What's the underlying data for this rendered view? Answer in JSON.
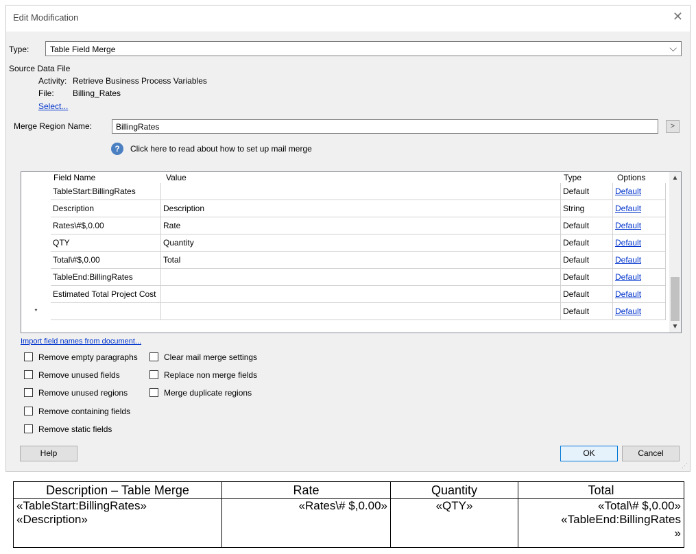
{
  "dialog": {
    "title": "Edit Modification",
    "type_label": "Type:",
    "type_value": "Table Field Merge",
    "source_heading": "Source Data File",
    "activity_label": "Activity:",
    "activity_value": "Retrieve Business Process Variables",
    "file_label": "File:",
    "file_value": "Billing_Rates",
    "select_link": "Select...",
    "merge_region_label": "Merge Region Name:",
    "merge_region_value": "BillingRates",
    "merge_region_button": ">",
    "help_text": "Click here to read about how to set up mail merge",
    "grid": {
      "headers": [
        "Field Name",
        "Value",
        "Type",
        "Options"
      ],
      "rows": [
        {
          "field": "TableStart:BillingRates",
          "value": "",
          "type": "Default",
          "option": "Default"
        },
        {
          "field": "Description",
          "value": "Description",
          "type": "String",
          "option": "Default"
        },
        {
          "field": "Rates\\#$,0.00",
          "value": "Rate",
          "type": "Default",
          "option": "Default"
        },
        {
          "field": "QTY",
          "value": "Quantity",
          "type": "Default",
          "option": "Default"
        },
        {
          "field": "Total\\#$,0.00",
          "value": "Total",
          "type": "Default",
          "option": "Default"
        },
        {
          "field": "TableEnd:BillingRates",
          "value": "",
          "type": "Default",
          "option": "Default"
        },
        {
          "field": "Estimated Total Project Cost",
          "value": "",
          "type": "Default",
          "option": "Default"
        },
        {
          "field": "",
          "value": "",
          "type": "Default",
          "option": "Default"
        }
      ],
      "new_row_marker": "*"
    },
    "import_link": "Import field names from document...",
    "checkboxes": [
      "Remove empty paragraphs",
      "Remove unused fields",
      "Remove unused regions",
      "Remove containing fields",
      "Remove static fields",
      "Clear mail merge settings",
      "Replace non merge fields",
      "Merge duplicate regions"
    ],
    "help_button": "Help",
    "ok_button": "OK",
    "cancel_button": "Cancel"
  },
  "document_table": {
    "headers": [
      "Description – Table Merge",
      "Rate",
      "Quantity",
      "Total"
    ],
    "cells": {
      "description_1": "«TableStart:BillingRates»",
      "description_2": "«Description»",
      "rate": "«Rates\\# $,0.00»",
      "quantity": "«QTY»",
      "total_1": "«Total\\# $,0.00»",
      "total_2": "«TableEnd:BillingRates",
      "total_3": "»"
    }
  },
  "colors": {
    "dialog_bg": "#f0f0f0",
    "link": "#0033cc",
    "ok_border": "#0078d7"
  }
}
